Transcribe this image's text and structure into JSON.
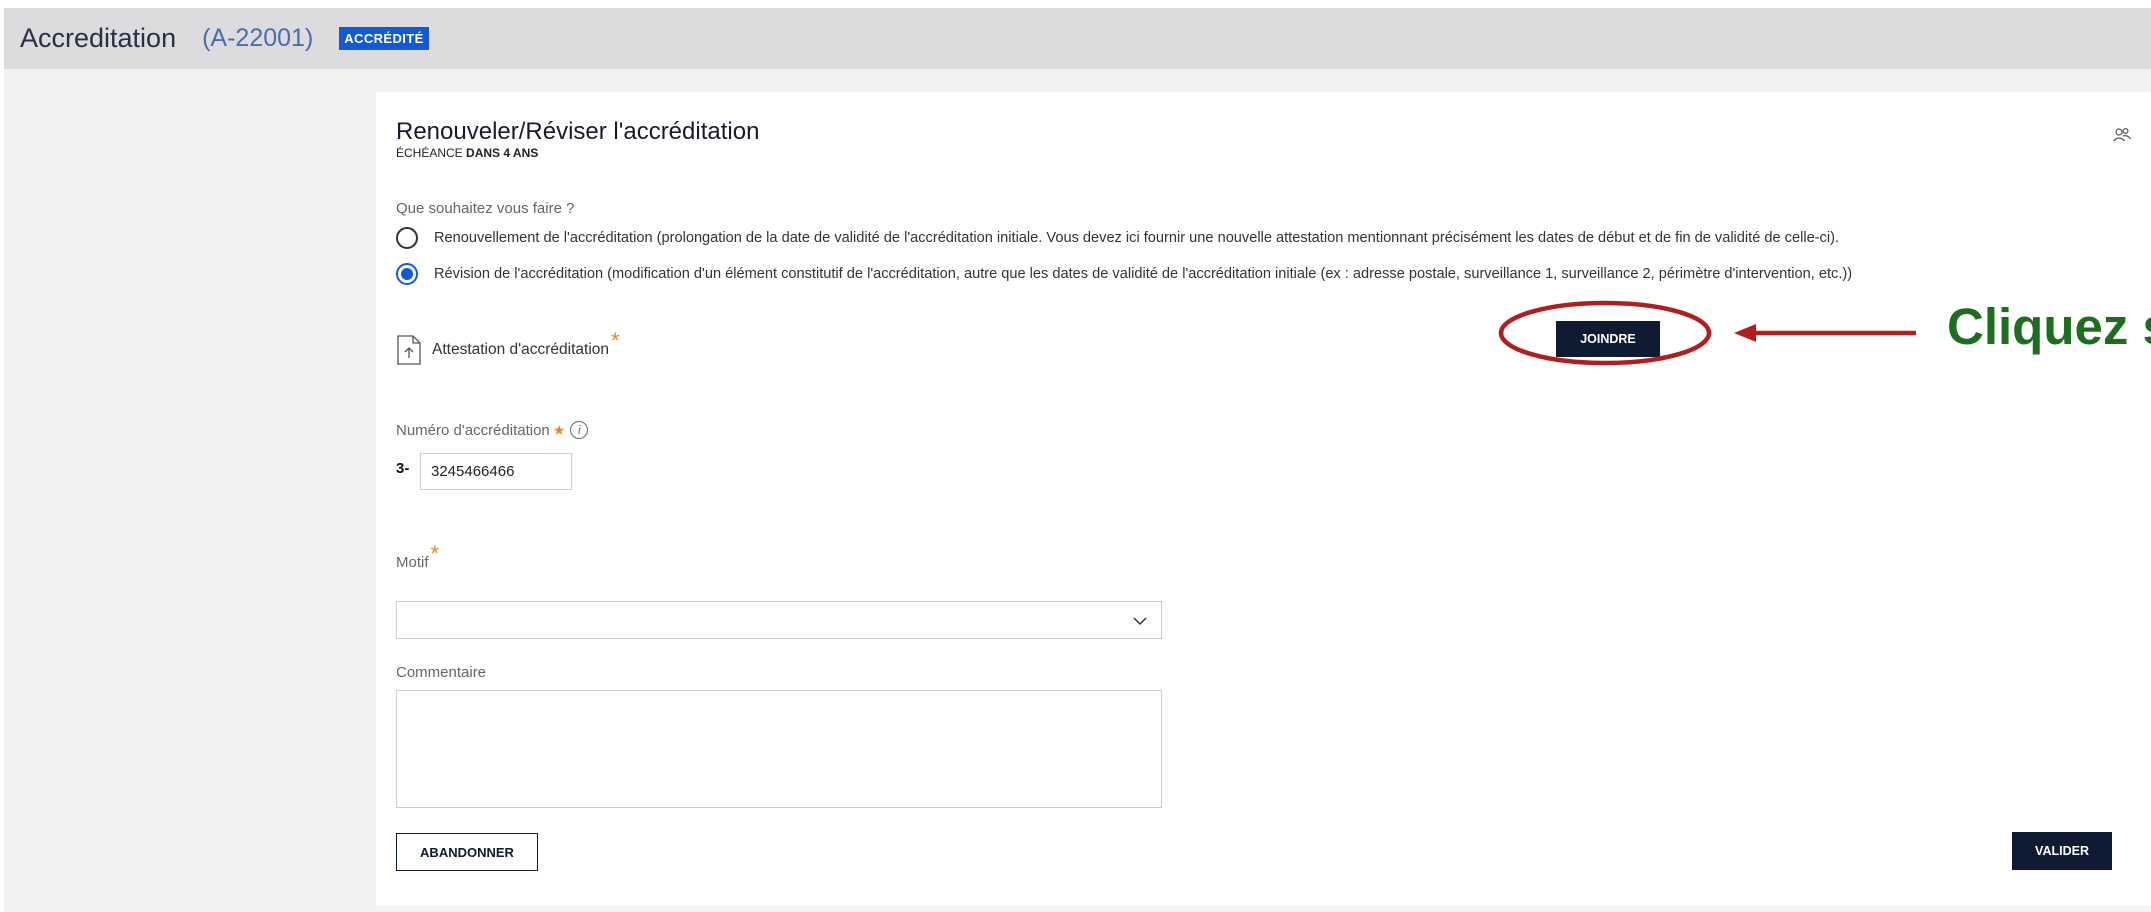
{
  "header": {
    "title": "Accreditation",
    "code": "(A-22001)",
    "status_badge": "ACCRÉDITÉ"
  },
  "card": {
    "title": "Renouveler/Réviser l'accréditation",
    "due_prefix": "ÉCHÉANCE",
    "due_value": "DANS 4 ANS",
    "question": "Que souhaitez vous faire ?",
    "options": [
      {
        "label": "Renouvellement de l'accréditation (prolongation de la date de validité de l'accréditation initiale. Vous devez ici fournir une nouvelle attestation mentionnant précisément les dates de début et de fin de validité de celle-ci).",
        "selected": false
      },
      {
        "label": "Révision de l'accréditation (modification d'un élément constitutif de l'accréditation, autre que les dates de validité de l'accréditation initiale (ex : adresse postale, surveillance 1, surveillance 2, périmètre d'intervention, etc.))",
        "selected": true
      }
    ],
    "attestation_label": "Attestation d'accréditation",
    "required_mark": "*",
    "joindre_label": "JOINDRE",
    "number_label": "Numéro d'accréditation",
    "number_info": "i",
    "number_prefix": "3-",
    "number_value": "3245466466",
    "motif_label": "Motif",
    "motif_value": "",
    "comment_label": "Commentaire",
    "comment_value": "",
    "cancel_label": "ABANDONNER",
    "submit_label": "VALIDER"
  },
  "icons": {
    "upload": "upload-file-icon",
    "people": "people-icon",
    "chevron": "chevron-down-icon",
    "info": "info-icon"
  },
  "annotation": {
    "text": "Cliquez sur",
    "color": "#b01e1e",
    "text_color": "#1f6d1f"
  }
}
